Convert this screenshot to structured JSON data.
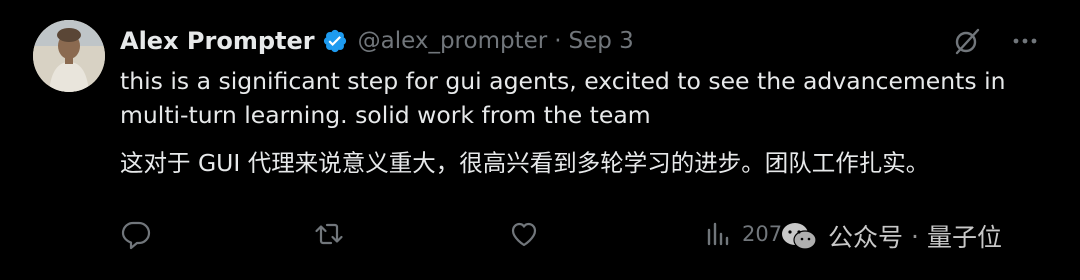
{
  "tweet": {
    "author": {
      "name": "Alex Prompter",
      "handle": "@alex_prompter",
      "verified": true
    },
    "separator": "·",
    "date": "Sep 3",
    "text_en": "this is a significant step for gui agents, excited to see the advancements in\nmulti-turn learning. solid work from the team",
    "text_zh": "这对于 GUI 代理来说意义重大，很高兴看到多轮学习的进步。团队工作扎实。",
    "actions": {
      "views": "207"
    }
  },
  "icons": {
    "verified": "verified-badge-icon",
    "grok": "grok-icon",
    "more": "more-icon",
    "reply": "reply-icon",
    "repost": "repost-icon",
    "like": "like-icon",
    "views": "views-icon"
  },
  "watermark": {
    "brand": "公众号",
    "separator": "·",
    "name": "量子位"
  },
  "colors": {
    "background": "#000000",
    "text": "#e7e9ea",
    "secondary": "#71767b",
    "verified": "#1d9bf0"
  }
}
